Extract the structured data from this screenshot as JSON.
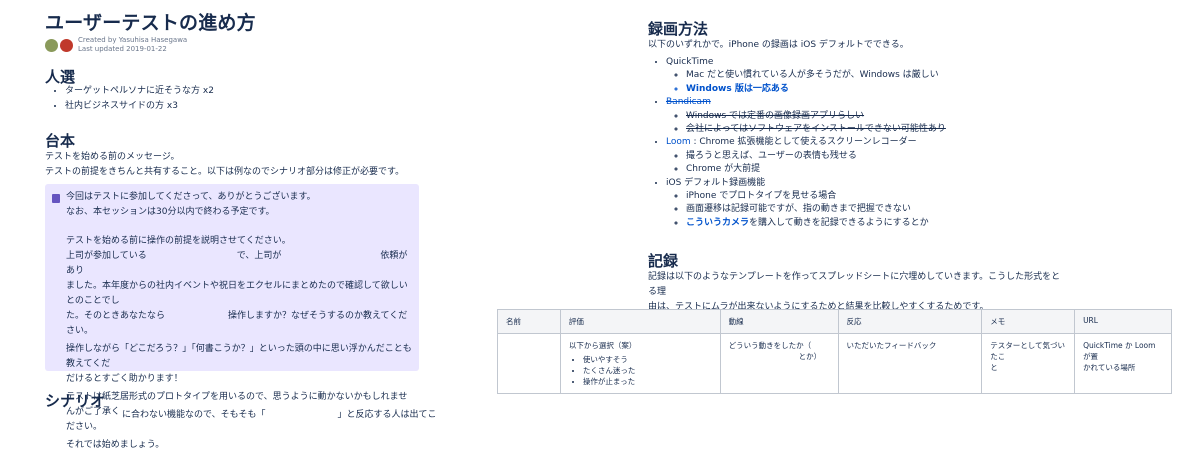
{
  "left": {
    "title": "ユーザーテストの進め方",
    "meta": {
      "created_by": "Created by Yasuhisa Hasegawa",
      "last_updated": "Last updated 2019-01-22"
    },
    "section_selection": {
      "heading": "人選",
      "items": [
        "ターゲットペルソナに近そうな方 x2",
        "社内ビジネスサイドの方 x3"
      ]
    },
    "section_script": {
      "heading": "台本",
      "intro_lines": [
        "テストを始める前のメッセージ。",
        "テストの前提をきちんと共有すること。以下は例なのでシナリオ部分は修正が必要です。"
      ]
    },
    "panel": {
      "lines": [
        "今回はテストに参加してくださって、ありがとうございます。",
        "なお、本セッションは30分以内で終わる予定です。",
        "テストを始める前に操作の前提を説明させてください。",
        "上司が参加している　　　　　　　　　　で、上司が　　　　　　　　　　　依頼があり",
        "ました。本年度からの社内イベントや祝日をエクセルにまとめたので確認して欲しいとのことでし",
        "た。そのときあなたなら　　　　　　　操作しますか？なぜそうするのか教えてください。",
        "操作しながら「どこだろう？」「何書こうか？」といった頭の中に思い浮かんだことも教えてくだ",
        "だけるとすごく助かります！",
        "テストは紙芝居形式のプロトタイプを用いるので、思うように動かないかもしれませんがご了承く",
        "ださい。",
        "それでは始めましょう。"
      ]
    },
    "section_scenario": {
      "heading": "シナリオ",
      "cut_text": "に合わない機能なので、そもそも「　　　　　　　　」と反応する人は出てこ"
    }
  },
  "right": {
    "section_recording": {
      "heading": "録画方法",
      "intro": "以下のいずれかで。iPhone の録画は iOS デフォルトでできる。",
      "items": [
        {
          "label": "QuickTime",
          "style": "plain",
          "children": [
            {
              "label": "Mac だと使い慣れている人が多そうだが、Windows は厳しい",
              "style": "plain"
            },
            {
              "label": "Windows 版は一応ある",
              "style": "link-bold"
            }
          ]
        },
        {
          "label": "Bandicam",
          "style": "link-strike",
          "children": [
            {
              "label": "Windows では定番の画像録画アプリらしい",
              "style": "strike"
            },
            {
              "label": "会社によってはソフトウェアをインストールできない可能性あり",
              "style": "strike"
            }
          ]
        },
        {
          "label": "Loom",
          "suffix": " : Chrome 拡張機能として使えるスクリーンレコーダー",
          "style": "link",
          "children": [
            {
              "label": "撮ろうと思えば、ユーザーの表情も残せる",
              "style": "plain"
            },
            {
              "label": "Chrome が大前提",
              "style": "plain"
            }
          ]
        },
        {
          "label": "iOS デフォルト録画機能",
          "style": "plain",
          "children": [
            {
              "label": "iPhone でプロトタイプを見せる場合",
              "style": "plain"
            },
            {
              "label": "画面遷移は記録可能ですが、指の動きまで把握できない",
              "style": "plain"
            },
            {
              "label": "こういうカメラ",
              "suffix": "を購入して動きを記録できるようにするとか",
              "style": "link"
            }
          ]
        }
      ]
    },
    "section_record": {
      "heading": "記録",
      "intro_lines": [
        "記録は以下のようなテンプレートを作ってスプレッドシートに穴埋めしていきます。こうした形式をとる理",
        "由は、テストにムラが出来ないようにするためと結果を比較しやすくするためです。"
      ],
      "table": {
        "headers": [
          "名前",
          "評価",
          "動線",
          "反応",
          "メモ",
          "URL"
        ],
        "row": {
          "name": "",
          "rating_intro": "以下から選択（案）",
          "rating_options": [
            "使いやすそう",
            "たくさん迷った",
            "操作が止まった"
          ],
          "flow_line1": "どういう動きをしたか（",
          "flow_line2": "とか）",
          "reaction": "いただいたフィードバック",
          "memo_line1": "テスターとして気づいたこ",
          "memo_line2": "と",
          "url_line1": "QuickTime か Loom が置",
          "url_line2": "かれている場所"
        }
      }
    }
  }
}
